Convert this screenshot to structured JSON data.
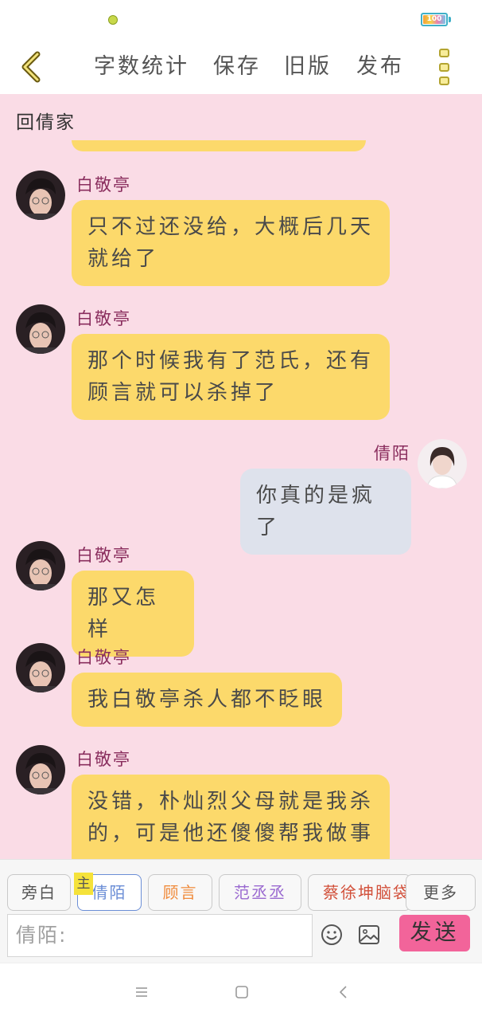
{
  "status_bar": {
    "battery_level": "100"
  },
  "toolbar": {
    "back_icon": "chevron-left-icon",
    "word_count_label": "字数统计",
    "save_label": "保存",
    "old_version_label": "旧版",
    "publish_label": "发布",
    "more_icon": "more-vertical-icon"
  },
  "chat": {
    "header": "回倩家",
    "messages": [
      {
        "sender": "白敬亭",
        "side": "left",
        "text": "只不过还没给，大概后几天就给了"
      },
      {
        "sender": "白敬亭",
        "side": "left",
        "text": "那个时候我有了范氏，还有顾言就可以杀掉了"
      },
      {
        "sender": "倩陌",
        "side": "right",
        "text": "你真的是疯了"
      },
      {
        "sender": "白敬亭",
        "side": "left",
        "text": "那又怎样"
      },
      {
        "sender": "白敬亭",
        "side": "left",
        "text": "我白敬亭杀人都不眨眼"
      },
      {
        "sender": "白敬亭",
        "side": "left",
        "text": "没错，朴灿烈父母就是我杀的，可是他还傻傻帮我做事"
      }
    ]
  },
  "input_area": {
    "roles": {
      "narrator": "旁白",
      "qingmo": "倩陌",
      "guyan": "顾言",
      "fanchengcheng": "范丞丞",
      "caixukun": "蔡徐坤脑袋",
      "more": "更多"
    },
    "main_badge": "主",
    "input_placeholder": "倩陌:",
    "emoji_icon": "smiley-icon",
    "image_icon": "image-icon",
    "send_label": "发送"
  },
  "colors": {
    "chat_background": "#fadce6",
    "left_bubble": "#fcd96b",
    "right_bubble": "#dee2ec",
    "sender_name": "#8a2e5e",
    "send_button": "#f2649a"
  },
  "nav": {
    "menu_icon": "menu-icon",
    "home_icon": "square-home-icon",
    "back_icon": "triangle-back-icon"
  }
}
